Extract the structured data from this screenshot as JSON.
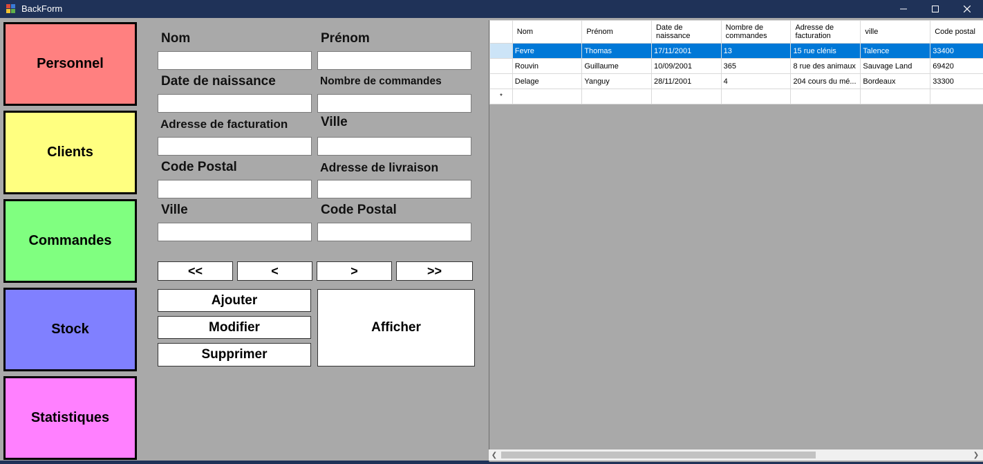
{
  "window": {
    "title": "BackForm"
  },
  "nav": {
    "items": [
      {
        "label": "Personnel",
        "color": "#ff8080"
      },
      {
        "label": "Clients",
        "color": "#ffff80"
      },
      {
        "label": "Commandes",
        "color": "#80ff80"
      },
      {
        "label": "Stock",
        "color": "#8080ff"
      },
      {
        "label": "Statistiques",
        "color": "#ff80ff"
      }
    ]
  },
  "form": {
    "nom_label": "Nom",
    "prenom_label": "Prénom",
    "date_label": "Date de naissance",
    "nb_commandes_label": "Nombre de commandes",
    "adresse_fact_label": "Adresse de facturation",
    "ville_label": "Ville",
    "cp_label": "Code Postal",
    "adresse_liv_label": "Adresse de livraison",
    "ville2_label": "Ville",
    "cp2_label": "Code Postal"
  },
  "navigation": {
    "first": "<<",
    "prev": "<",
    "next": ">",
    "last": ">>"
  },
  "actions": {
    "add": "Ajouter",
    "modify": "Modifier",
    "delete": "Supprimer",
    "show": "Afficher"
  },
  "grid": {
    "columns": [
      "Nom",
      "Prénom",
      "Date de\nnaissance",
      "Nombre de\ncommandes",
      "Adresse de\nfacturation",
      "ville",
      "Code postal"
    ],
    "rows": [
      [
        "Fevre",
        "Thomas",
        "17/11/2001",
        "13",
        "15 rue clénis",
        "Talence",
        "33400"
      ],
      [
        "Rouvin",
        "Guillaume",
        "10/09/2001",
        "365",
        "8 rue des animaux",
        "Sauvage Land",
        "69420"
      ],
      [
        "Delage",
        "Yanguy",
        "28/11/2001",
        "4",
        "204 cours du mé...",
        "Bordeaux",
        "33300"
      ]
    ],
    "new_row_marker": "*"
  }
}
